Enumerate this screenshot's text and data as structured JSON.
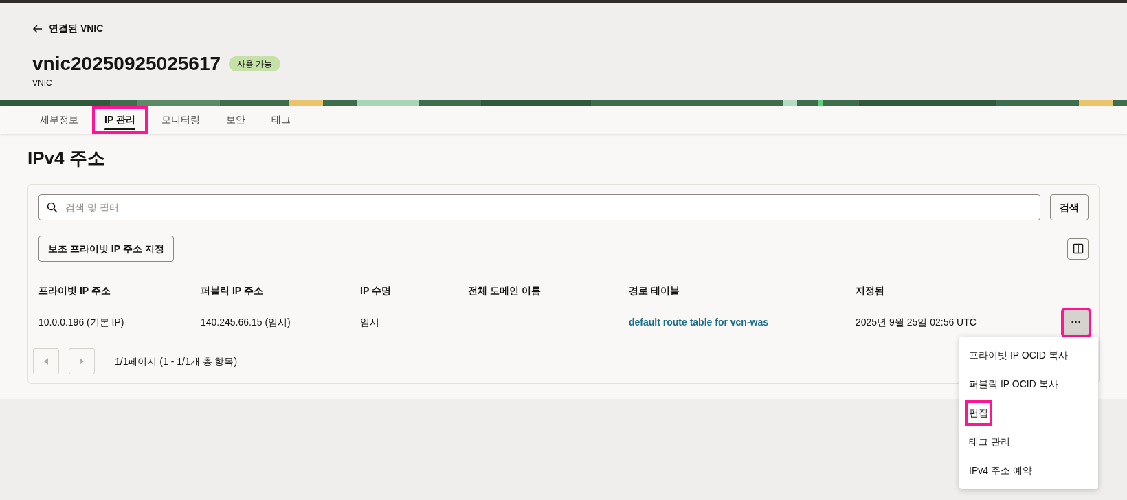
{
  "back_link": {
    "label": "연결된 VNIC"
  },
  "header": {
    "title": "vnic20250925025617",
    "status": "사용 가능",
    "subtitle": "VNIC"
  },
  "tabs": [
    {
      "label": "세부정보",
      "selected": false,
      "highlighted": false
    },
    {
      "label": "IP 관리",
      "selected": true,
      "highlighted": true
    },
    {
      "label": "모니터링",
      "selected": false,
      "highlighted": false
    },
    {
      "label": "보안",
      "selected": false,
      "highlighted": false
    },
    {
      "label": "태그",
      "selected": false,
      "highlighted": false
    }
  ],
  "section_title": "IPv4 주소",
  "search": {
    "placeholder": "검색 및 필터",
    "button": "검색"
  },
  "assign_button": "보조 프라이빗 IP 주소 지정",
  "table": {
    "columns": [
      "프라이빗 IP 주소",
      "퍼블릭 IP 주소",
      "IP 수명",
      "전체 도메인 이름",
      "경로 테이블",
      "지정됨"
    ],
    "rows": [
      {
        "cells": [
          "10.0.0.196 (기본 IP)",
          "140.245.66.15 (임시)",
          "임시",
          "—",
          "default route table for vcn-was",
          "2025년 9월 25일 02:56 UTC"
        ],
        "actions": "···",
        "actions_highlighted": true
      }
    ]
  },
  "pagination": {
    "summary": "1/1페이지 (1 - 1/1개 총 항목)"
  },
  "menu": {
    "items": [
      {
        "label": "프라이빗 IP OCID 복사",
        "highlighted": false
      },
      {
        "label": "퍼블릭 IP OCID 복사",
        "highlighted": false
      },
      {
        "label": "편집",
        "highlighted": true
      },
      {
        "label": "태그 관리",
        "highlighted": false
      },
      {
        "label": "IPv4 주소 예약",
        "highlighted": false
      }
    ]
  }
}
